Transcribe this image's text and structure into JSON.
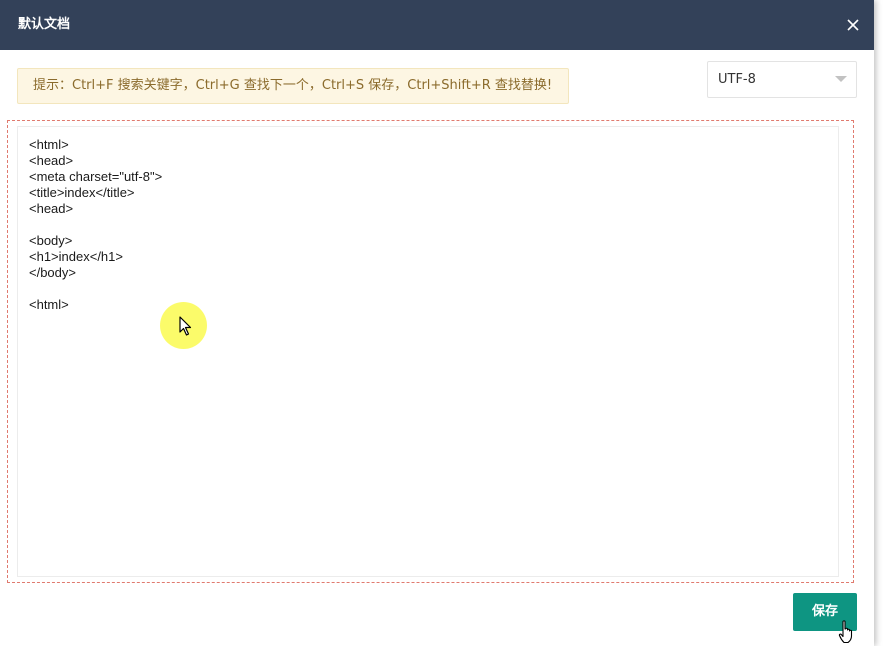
{
  "dialog": {
    "title": "默认文档",
    "close_icon": "close-icon"
  },
  "hint": {
    "text": "提示：Ctrl+F 搜索关键字，Ctrl+G 查找下一个，Ctrl+S 保存，Ctrl+Shift+R 查找替换!"
  },
  "encoding": {
    "selected": "UTF-8",
    "icon": "chevron-down-icon"
  },
  "editor": {
    "lines": [
      "<html>",
      "<head>",
      "<meta charset=\"utf-8\">",
      "<title>index</title>",
      "<head>",
      "",
      "<body>",
      "<h1>index</h1>",
      "</body>",
      "",
      "<html>"
    ]
  },
  "footer": {
    "save_label": "保存"
  },
  "colors": {
    "titlebar": "#334159",
    "save_button": "#0e9582",
    "hint_background": "#fdf6e3",
    "editor_border": "#e07a6e"
  }
}
